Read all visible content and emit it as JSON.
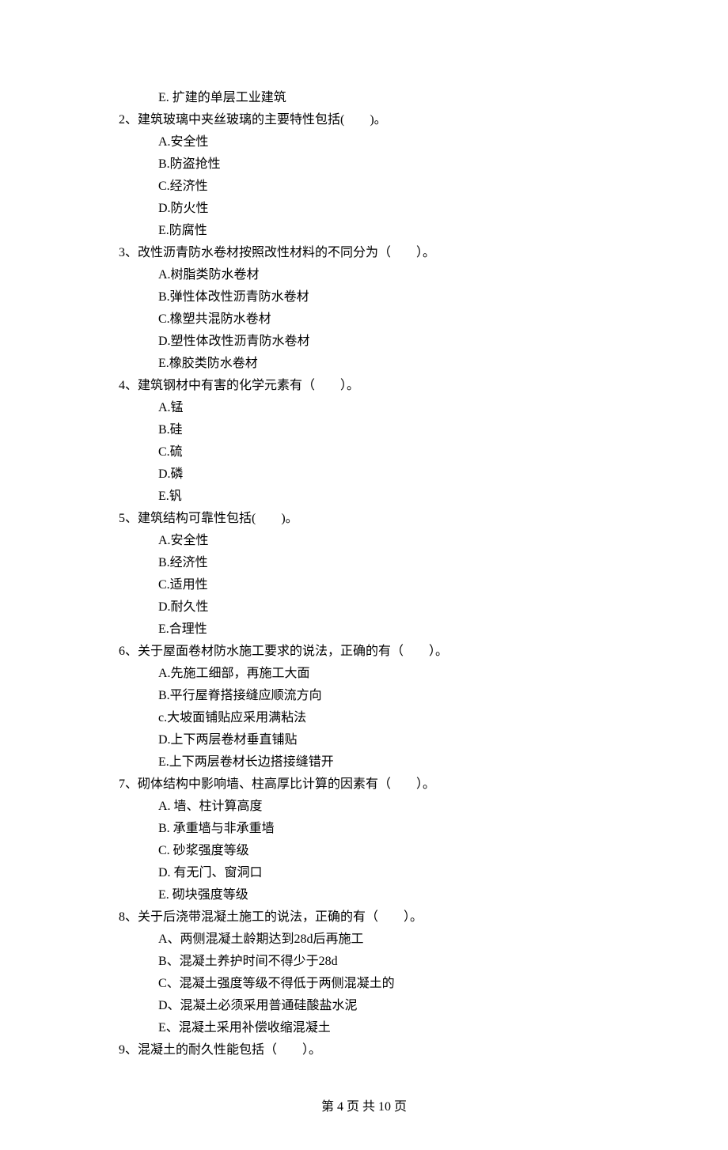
{
  "orphan_option": "E. 扩建的单层工业建筑",
  "questions": [
    {
      "num": "2、",
      "text": "建筑玻璃中夹丝玻璃的主要特性包括(　　)。",
      "options": [
        "A.安全性",
        "B.防盗抢性",
        "C.经济性",
        "D.防火性",
        "E.防腐性"
      ]
    },
    {
      "num": "3、",
      "text": "改性沥青防水卷材按照改性材料的不同分为（　　）。",
      "options": [
        "A.树脂类防水卷材",
        "B.弹性体改性沥青防水卷材",
        "C.橡塑共混防水卷材",
        "D.塑性体改性沥青防水卷材",
        "E.橡胶类防水卷材"
      ]
    },
    {
      "num": "4、",
      "text": "建筑钢材中有害的化学元素有（　　）。",
      "options": [
        "A.锰",
        "B.硅",
        "C.硫",
        "D.磷",
        "E.钒"
      ]
    },
    {
      "num": "5、",
      "text": "建筑结构可靠性包括(　　)。",
      "options": [
        "A.安全性",
        "B.经济性",
        "C.适用性",
        "D.耐久性",
        "E.合理性"
      ]
    },
    {
      "num": "6、",
      "text": "关于屋面卷材防水施工要求的说法，正确的有（　　）。",
      "options": [
        "A.先施工细部，再施工大面",
        "B.平行屋脊搭接缝应顺流方向",
        "c.大坡面铺贴应采用满粘法",
        "D.上下两层卷材垂直铺贴",
        "E.上下两层卷材长边搭接缝错开"
      ]
    },
    {
      "num": "7、",
      "text": "砌体结构中影响墙、柱高厚比计算的因素有（　　）。",
      "options": [
        "A. 墙、柱计算高度",
        "B. 承重墙与非承重墙",
        "C. 砂浆强度等级",
        "D. 有无门、窗洞口",
        "E. 砌块强度等级"
      ]
    },
    {
      "num": "8、",
      "text": "关于后浇带混凝土施工的说法，正确的有（　　）。",
      "options": [
        "A、两侧混凝土龄期达到28d后再施工",
        "B、混凝土养护时间不得少于28d",
        "C、混凝土强度等级不得低于两侧混凝土的",
        "D、混凝土必须采用普通硅酸盐水泥",
        "E、混凝土采用补偿收缩混凝土"
      ]
    },
    {
      "num": "9、",
      "text": "混凝土的耐久性能包括（　　）。",
      "options": []
    }
  ],
  "footer": "第 4 页 共 10 页"
}
